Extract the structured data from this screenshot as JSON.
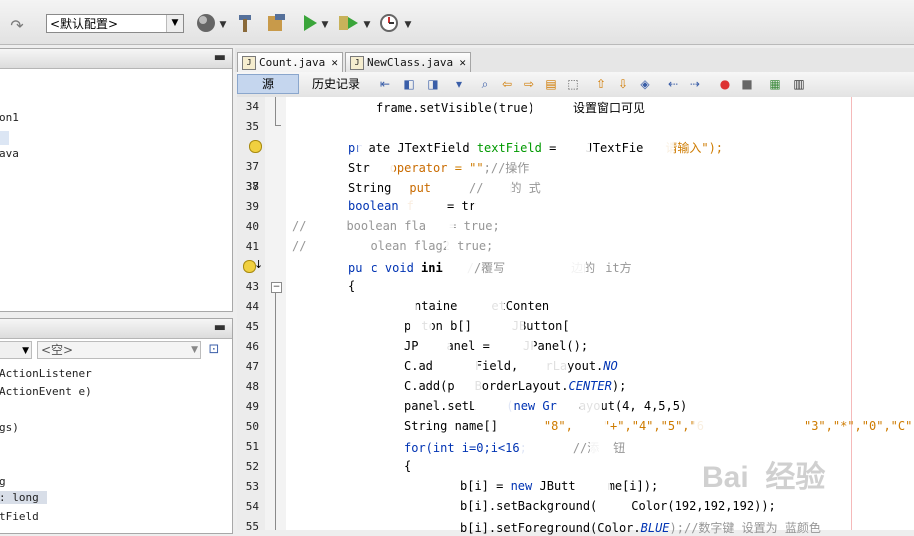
{
  "toolbar": {
    "config_value": "<默认配置>"
  },
  "left_panel": {
    "top_lines": [
      "on1",
      "ava"
    ],
    "filter_placeholder": "<空>",
    "nav_lines": [
      " ActionListener",
      "ActionEvent e)",
      "gs)",
      "g",
      ": long",
      "tField"
    ]
  },
  "editor": {
    "tabs": [
      {
        "label": "Count.java",
        "active": true
      },
      {
        "label": "NewClass.java",
        "active": false
      }
    ],
    "source_button": "源",
    "history_button": "历史记录",
    "line_numbers": [
      "34",
      "35",
      "36",
      "37",
      "38",
      "39",
      "40",
      "41",
      "42",
      "43",
      "44",
      "45",
      "46",
      "47",
      "48",
      "49",
      "50",
      "51",
      "52",
      "53",
      "54",
      "55"
    ],
    "code_lines": {
      "l34a": "frame.setVisible(true)",
      "l34b": "设置窗口可见",
      "l36a": "pr",
      "l36b": "ate JTextField ",
      "l36c": "textField",
      "l36d": " = ",
      "l36e": "JTextFie",
      "l36f": "请输入\");",
      "l37a": "Str",
      "l37b": "operator",
      "l37c": " = ",
      "l37d": "\"\"",
      "l37e": ";//操作",
      "l38a": "String",
      "l38b": "put",
      "l38c": "//",
      "l38d": "的 式",
      "l39a": "boolean",
      "l39b": "f",
      "l39c": " = tr",
      "l40a": "//",
      "l40b": "boolean fla",
      "l40c": " = true;",
      "l41a": "//",
      "l41b": "olean flag2",
      "l41c": " true;",
      "l42a": "pu",
      "l42b": "c void ",
      "l42c": "ini",
      "l42d": "//覆写",
      "l42e": "边的",
      "l42f": "it方",
      "l43": "{",
      "l44a": "ntaine",
      "l44b": "etConten",
      "l45a": "p",
      "l45b": "ton b[]",
      "l45c": "JButton[",
      "l46a": "JP",
      "l46b": "anel = ",
      "l46c": "JPanel();",
      "l47a": "C.ad",
      "l47b": "Field, ",
      "l47c": "rLayout.",
      "l47d": "NO",
      "l48a": "C.add(p",
      "l48b": "BorderLayout.",
      "l48c": "CENTER",
      "l48d": ");",
      "l49a": "panel.setL",
      "l49b": "(new Gr",
      "l49c": "ayout(4, 4,5,5)",
      "l50a": "String name[]",
      "l50b": "\"8\",",
      "l50c": "\"+\",\"4\",\"5\",\"6",
      "l50d": "\"3\",\"*\",\"0\",\"C\",\"=",
      "l51a": "for(int i=0;i<16;",
      "l51b": "//添",
      "l51c": "钮",
      "l52": "{",
      "l53a": "b[i] = ",
      "l53b": "new",
      "l53c": " JButt",
      "l53d": "me[i]);",
      "l54a": "b[i].setBackground(",
      "l54b": "Color(192,192,192));",
      "l55a": "b[i].setForeground(Color.",
      "l55b": "BLUE",
      "l55c": ");//数字键 设置为 蓝颜色"
    }
  },
  "watermark": "Bai  经验"
}
